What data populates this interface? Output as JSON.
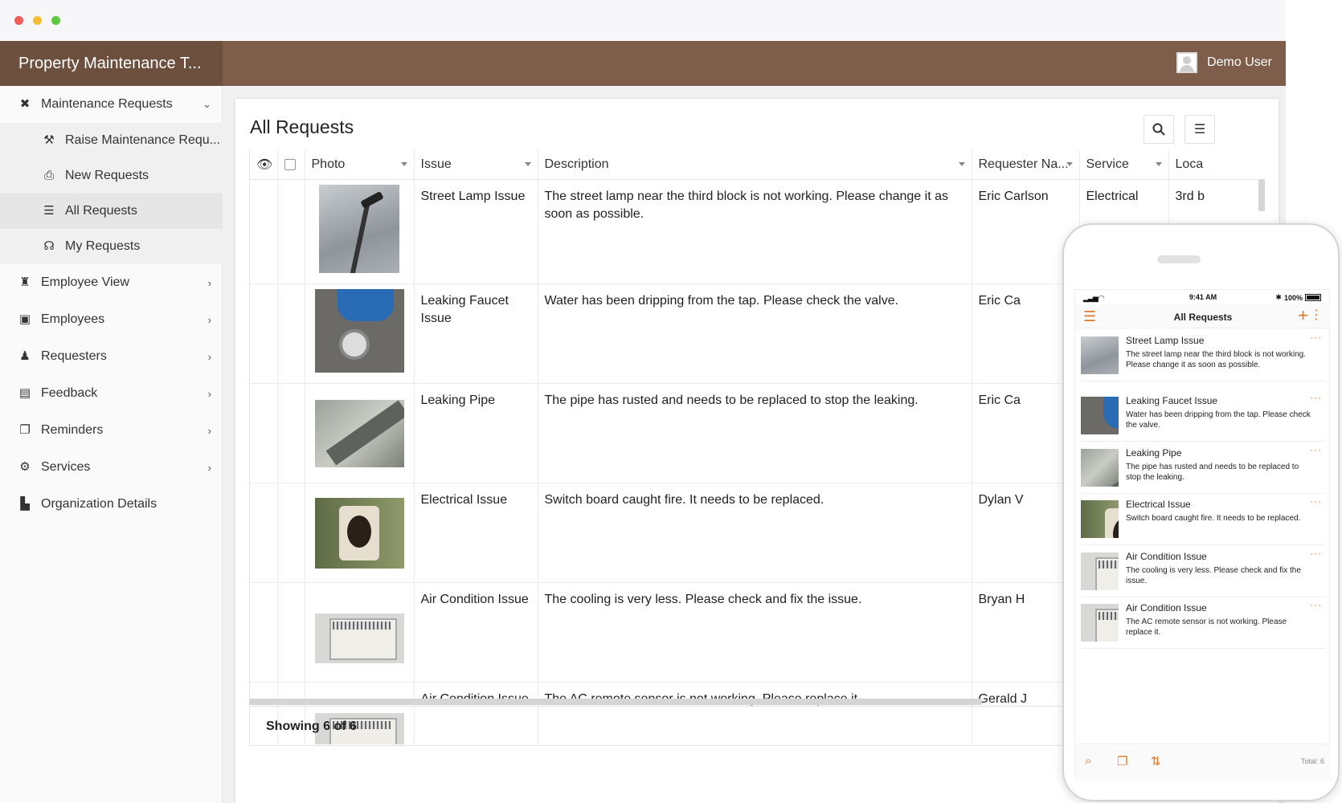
{
  "app": {
    "title": "Property Maintenance T...",
    "user_name": "Demo User"
  },
  "sidebar": {
    "items": [
      {
        "label": "Maintenance Requests",
        "icon": "tools-icon",
        "chevron": "down"
      },
      {
        "label": "Raise Maintenance Requ...",
        "icon": "hammer-icon"
      },
      {
        "label": "New Requests",
        "icon": "inbox-icon"
      },
      {
        "label": "All Requests",
        "icon": "list-icon",
        "active": true
      },
      {
        "label": "My Requests",
        "icon": "user-voice-icon"
      },
      {
        "label": "Employee View",
        "icon": "worker-icon",
        "chevron": "right"
      },
      {
        "label": "Employees",
        "icon": "id-card-icon",
        "chevron": "right"
      },
      {
        "label": "Requesters",
        "icon": "people-icon",
        "chevron": "right"
      },
      {
        "label": "Feedback",
        "icon": "comment-icon",
        "chevron": "right"
      },
      {
        "label": "Reminders",
        "icon": "copy-icon",
        "chevron": "right"
      },
      {
        "label": "Services",
        "icon": "gear-icon",
        "chevron": "right"
      },
      {
        "label": "Organization Details",
        "icon": "building-icon"
      }
    ]
  },
  "main": {
    "title": "All Requests",
    "columns": [
      "Photo",
      "Issue",
      "Description",
      "Requester Na...",
      "Service",
      "Loca"
    ],
    "rows": [
      {
        "photo": "street-lamp-photo",
        "issue": "Street Lamp Issue",
        "description": "The street lamp near the third block is not working. Please change it as soon as possible.",
        "requester": "Eric Carlson",
        "service": "Electrical",
        "location": "3rd b"
      },
      {
        "photo": "leaking-faucet-photo",
        "issue": "Leaking Faucet Issue",
        "description": "Water has been dripping from the tap. Please check the valve.",
        "requester": "Eric Ca",
        "service": "",
        "location": ""
      },
      {
        "photo": "leaking-pipe-photo",
        "issue": "Leaking Pipe",
        "description": "The pipe has rusted and needs to be replaced to stop the leaking.",
        "requester": "Eric Ca",
        "service": "",
        "location": ""
      },
      {
        "photo": "electrical-outlet-photo",
        "issue": "Electrical Issue",
        "description": "Switch board caught fire. It needs to be replaced.",
        "requester": "Dylan V",
        "service": "",
        "location": ""
      },
      {
        "photo": "air-conditioner-photo",
        "issue": "Air Condition Issue",
        "description": "The cooling is very less. Please check and fix the issue.",
        "requester": "Bryan H",
        "service": "",
        "location": ""
      },
      {
        "photo": "air-conditioner-photo",
        "issue": "Air Condition Issue",
        "description": "The AC remote sensor is not working. Please replace it.",
        "requester": "Gerald J",
        "service": "",
        "location": ""
      }
    ],
    "footer": "Showing 6 of 6"
  },
  "mobile": {
    "time": "9:41 AM",
    "battery": "100%",
    "title": "All Requests",
    "items": [
      {
        "title": "Street Lamp Issue",
        "desc": "The street lamp near the third block is not working. Please change it as soon as possible."
      },
      {
        "title": "Leaking Faucet Issue",
        "desc": "Water has been dripping from the tap. Please check the valve."
      },
      {
        "title": "Leaking Pipe",
        "desc": "The pipe has rusted and needs to be replaced to stop the leaking."
      },
      {
        "title": "Electrical Issue",
        "desc": "Switch board caught fire. It needs to be replaced."
      },
      {
        "title": "Air Condition Issue",
        "desc": "The cooling is very less. Please check and fix the issue."
      },
      {
        "title": "Air Condition Issue",
        "desc": "The AC remote sensor is not working. Please replace it."
      }
    ],
    "total": "Total: 6"
  },
  "colors": {
    "appbar": "#7e5e4b",
    "brand": "#6d4f3e",
    "accent": "#e0782a",
    "close": "#ee5e57",
    "minimize": "#f5bd2f",
    "maximize": "#5fc63f"
  }
}
